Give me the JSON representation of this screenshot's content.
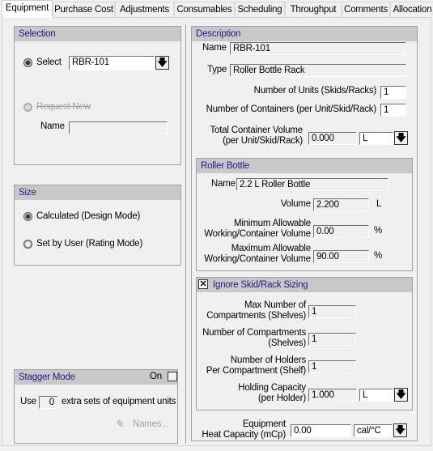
{
  "tabs": [
    "Equipment",
    "Purchase Cost",
    "Adjustments",
    "Consumables",
    "Scheduling",
    "Throughput",
    "Comments",
    "Allocation"
  ],
  "selection": {
    "title": "Selection",
    "select_label": "Select",
    "select_value": "RBR-101",
    "request_new_label": "Request New",
    "name_label": "Name",
    "name_value": ""
  },
  "size": {
    "title": "Size",
    "calculated_label": "Calculated (Design Mode)",
    "user_label": "Set by User (Rating Mode)"
  },
  "stagger": {
    "title": "Stagger Mode",
    "on_label": "On",
    "on_checked": false,
    "use_label": "Use",
    "extra_value": "0",
    "extra_label": "extra sets of equipment units",
    "names_button": "Names..."
  },
  "description": {
    "title": "Description",
    "name_label": "Name",
    "name_value": "RBR-101",
    "type_label": "Type",
    "type_value": "Roller Bottle Rack",
    "units_label": "Number of Units (Skids/Racks)",
    "units_value": "1",
    "containers_label": "Number of Containers (per Unit/Skid/Rack)",
    "containers_value": "1",
    "total_vol_label1": "Total Container Volume",
    "total_vol_label2": "(per Unit/Skid/Rack)",
    "total_vol_value": "0.000",
    "total_vol_unit": "L"
  },
  "roller_bottle": {
    "title": "Roller Bottle",
    "name_label": "Name",
    "name_value": "2.2 L Roller Bottle",
    "volume_label": "Volume",
    "volume_value": "2.200",
    "volume_unit": "L",
    "min_label1": "Minimum Allowable",
    "min_label2": "Working/Container Volume",
    "min_value": "0.00",
    "min_unit": "%",
    "max_label1": "Maximum Allowable",
    "max_label2": "Working/Container Volume",
    "max_value": "90.00",
    "max_unit": "%"
  },
  "ignore": {
    "title": "Ignore Skid/Rack Sizing",
    "checked": true,
    "maxcomp_label1": "Max Number of",
    "maxcomp_label2": "Compartments (Shelves)",
    "maxcomp_value": "1",
    "ncomp_label1": "Number of Compartments",
    "ncomp_label2": "(Shelves)",
    "ncomp_value": "1",
    "holders_label1": "Number of Holders",
    "holders_label2": "Per Compartment (Shelf)",
    "holders_value": "1",
    "hold_label1": "Holding Capacity",
    "hold_label2": "(per Holder)",
    "hold_value": "1.000",
    "hold_unit": "L"
  },
  "heat": {
    "label1": "Equipment",
    "label2": "Heat Capacity (mCp)",
    "value": "0.00",
    "unit": "cal/°C"
  }
}
